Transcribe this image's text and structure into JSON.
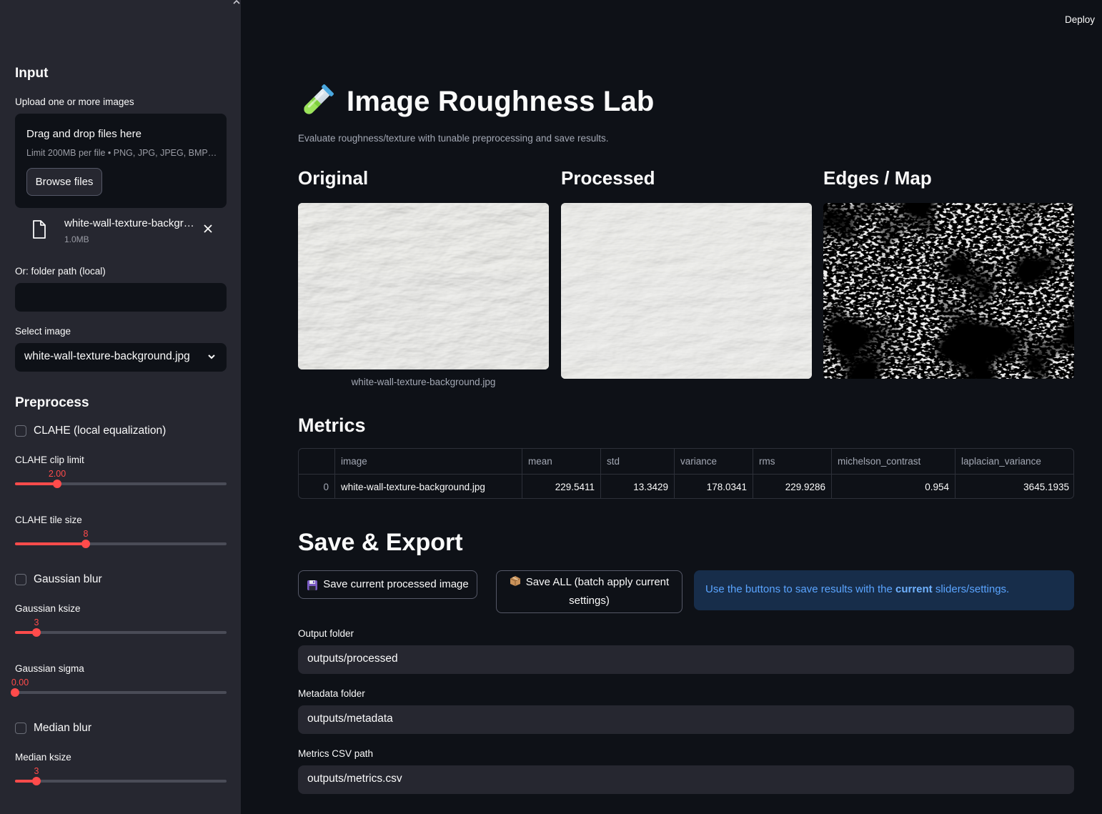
{
  "sidebar": {
    "input_heading": "Input",
    "upload_label": "Upload one or more images",
    "drag_drop": "Drag and drop files here",
    "limit": "Limit 200MB per file • PNG, JPG, JPEG, BMP…",
    "browse": "Browse files",
    "file_name": "white-wall-texture-backgr…",
    "file_size": "1.0MB",
    "folder_label": "Or: folder path (local)",
    "folder_value": "",
    "select_label": "Select image",
    "select_value": "white-wall-texture-background.jpg",
    "preprocess_heading": "Preprocess",
    "clahe_check": "CLAHE (local equalization)",
    "clahe_clip_label": "CLAHE clip limit",
    "clahe_clip_value": "2.00",
    "clahe_tile_label": "CLAHE tile size",
    "clahe_tile_value": "8",
    "gaussian_check": "Gaussian blur",
    "gaussian_ksize_label": "Gaussian ksize",
    "gaussian_ksize_value": "3",
    "gaussian_sigma_label": "Gaussian sigma",
    "gaussian_sigma_value": "0.00",
    "median_check": "Median blur",
    "median_ksize_label": "Median ksize",
    "median_ksize_value": "3"
  },
  "sliders": {
    "clahe_clip": 0.2,
    "clahe_tile": 0.333,
    "gaussian_ksize": 0.1,
    "gaussian_sigma": 0.0,
    "median_ksize": 0.1
  },
  "header": {
    "deploy": "Deploy"
  },
  "main": {
    "title": "Image Roughness Lab",
    "subtitle": "Evaluate roughness/texture with tunable preprocessing and save results.",
    "col_original": "Original",
    "col_processed": "Processed",
    "col_edges": "Edges / Map",
    "caption": "white-wall-texture-background.jpg",
    "metrics_heading": "Metrics",
    "save_heading": "Save & Export"
  },
  "table": {
    "headers": [
      "",
      "image",
      "mean",
      "std",
      "variance",
      "rms",
      "michelson_contrast",
      "laplacian_variance"
    ],
    "rows": [
      [
        "0",
        "white-wall-texture-background.jpg",
        "229.5411",
        "13.3429",
        "178.0341",
        "229.9286",
        "0.954",
        "3645.1935"
      ]
    ]
  },
  "export": {
    "save_current": "Save current processed image",
    "save_all_line1": "Save ALL (batch apply current",
    "save_all_line2": "settings)",
    "info_prefix": "Use the buttons to save results with the ",
    "info_bold": "current",
    "info_suffix": " sliders/settings.",
    "output_label": "Output folder",
    "output_value": "outputs/processed",
    "metadata_label": "Metadata folder",
    "metadata_value": "outputs/metadata",
    "csv_label": "Metrics CSV path",
    "csv_value": "outputs/metrics.csv"
  },
  "colors": {
    "accent": "#ff4b4b",
    "info_text": "#5aa4ff",
    "info_bg": "#172d4a"
  },
  "icons": [
    "test-tube-icon",
    "file-icon",
    "close-icon",
    "chevron-down-icon",
    "floppy-disk-icon",
    "package-icon",
    "collapse-chevron-icon"
  ]
}
